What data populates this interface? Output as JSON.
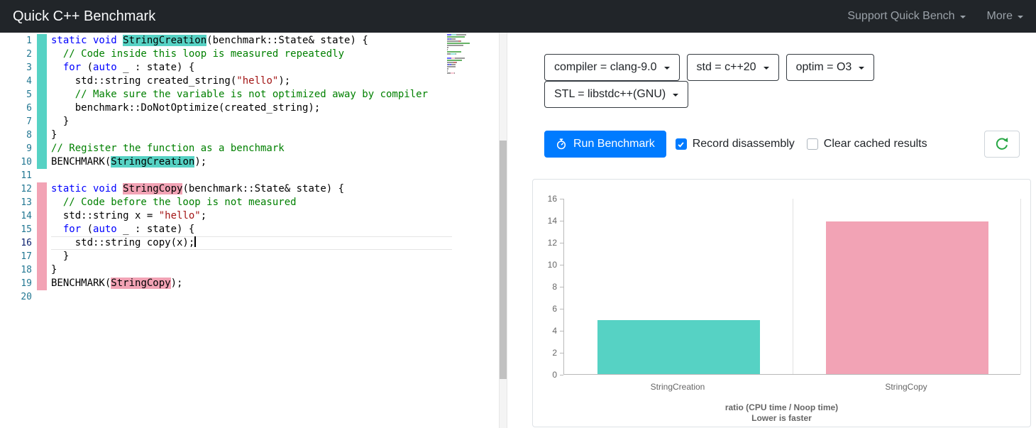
{
  "navbar": {
    "title": "Quick C++ Benchmark",
    "support_label": "Support Quick Bench",
    "more_label": "More"
  },
  "colors": {
    "teal": "#56d2c4",
    "pink": "#f2a3b5",
    "primary": "#007bff",
    "success": "#28a745",
    "keyword": "#0000ff",
    "comment": "#008000",
    "string": "#a31515"
  },
  "icons": {
    "caret_down": "caret-down-triangle",
    "run": "stopwatch-icon",
    "record_check": "checkmark-icon",
    "refresh": "refresh-icon"
  },
  "editor": {
    "lines": [
      {
        "n": 1,
        "stripe": "teal",
        "cur": false,
        "seg": [
          [
            "k",
            "static void "
          ],
          [
            "ht",
            "StringCreation"
          ],
          [
            "p",
            "(benchmark::State& state) {"
          ]
        ]
      },
      {
        "n": 2,
        "stripe": "teal",
        "cur": false,
        "seg": [
          [
            "c",
            "  // Code inside this loop is measured repeatedly"
          ]
        ]
      },
      {
        "n": 3,
        "stripe": "teal",
        "cur": false,
        "seg": [
          [
            "p",
            "  "
          ],
          [
            "k",
            "for"
          ],
          [
            "p",
            " ("
          ],
          [
            "k",
            "auto"
          ],
          [
            "p",
            " _ : state) {"
          ]
        ]
      },
      {
        "n": 4,
        "stripe": "teal",
        "cur": false,
        "seg": [
          [
            "p",
            "    std::string created_string("
          ],
          [
            "s",
            "\"hello\""
          ],
          [
            "p",
            ");"
          ]
        ]
      },
      {
        "n": 5,
        "stripe": "teal",
        "cur": false,
        "seg": [
          [
            "c",
            "    // Make sure the variable is not optimized away by compiler"
          ]
        ]
      },
      {
        "n": 6,
        "stripe": "teal",
        "cur": false,
        "seg": [
          [
            "p",
            "    benchmark::DoNotOptimize(created_string);"
          ]
        ]
      },
      {
        "n": 7,
        "stripe": "teal",
        "cur": false,
        "seg": [
          [
            "p",
            "  }"
          ]
        ]
      },
      {
        "n": 8,
        "stripe": "teal",
        "cur": false,
        "seg": [
          [
            "p",
            "}"
          ]
        ]
      },
      {
        "n": 9,
        "stripe": "teal",
        "cur": false,
        "seg": [
          [
            "c",
            "// Register the function as a benchmark"
          ]
        ]
      },
      {
        "n": 10,
        "stripe": "teal",
        "cur": false,
        "seg": [
          [
            "p",
            "BENCHMARK("
          ],
          [
            "ht",
            "StringCreation"
          ],
          [
            "p",
            ");"
          ]
        ]
      },
      {
        "n": 11,
        "stripe": null,
        "cur": false,
        "seg": []
      },
      {
        "n": 12,
        "stripe": "pink",
        "cur": false,
        "seg": [
          [
            "k",
            "static void "
          ],
          [
            "hp",
            "StringCopy"
          ],
          [
            "p",
            "(benchmark::State& state) {"
          ]
        ]
      },
      {
        "n": 13,
        "stripe": "pink",
        "cur": false,
        "seg": [
          [
            "c",
            "  // Code before the loop is not measured"
          ]
        ]
      },
      {
        "n": 14,
        "stripe": "pink",
        "cur": false,
        "seg": [
          [
            "p",
            "  std::string x = "
          ],
          [
            "s",
            "\"hello\""
          ],
          [
            "p",
            ";"
          ]
        ]
      },
      {
        "n": 15,
        "stripe": "pink",
        "cur": false,
        "seg": [
          [
            "p",
            "  "
          ],
          [
            "k",
            "for"
          ],
          [
            "p",
            " ("
          ],
          [
            "k",
            "auto"
          ],
          [
            "p",
            " _ : state) {"
          ]
        ]
      },
      {
        "n": 16,
        "stripe": "pink",
        "cur": true,
        "seg": [
          [
            "p",
            "    std::string copy(x);"
          ]
        ]
      },
      {
        "n": 17,
        "stripe": "pink",
        "cur": false,
        "seg": [
          [
            "p",
            "  }"
          ]
        ]
      },
      {
        "n": 18,
        "stripe": "pink",
        "cur": false,
        "seg": [
          [
            "p",
            "}"
          ]
        ]
      },
      {
        "n": 19,
        "stripe": "pink",
        "cur": false,
        "seg": [
          [
            "p",
            "BENCHMARK("
          ],
          [
            "hp",
            "StringCopy"
          ],
          [
            "p",
            ");"
          ]
        ]
      },
      {
        "n": 20,
        "stripe": null,
        "cur": false,
        "seg": []
      }
    ]
  },
  "controls": {
    "dropdowns": [
      "compiler = clang-9.0",
      "std = c++20",
      "optim = O3",
      "STL = libstdc++(GNU)"
    ],
    "run_button": "Run Benchmark",
    "checkboxes": [
      {
        "label": "Record disassembly",
        "checked": true
      },
      {
        "label": "Clear cached results",
        "checked": false
      }
    ]
  },
  "chart_data": {
    "type": "bar",
    "categories": [
      "StringCreation",
      "StringCopy"
    ],
    "values": [
      4.9,
      13.9
    ],
    "colors": [
      "#56d2c4",
      "#f2a3b5"
    ],
    "title": "ratio (CPU time / Noop time)",
    "subtitle": "Lower is faster",
    "xlabel": "",
    "ylabel": "",
    "ylim": [
      0,
      16
    ],
    "yticks": [
      0,
      2,
      4,
      6,
      8,
      10,
      12,
      14,
      16
    ],
    "grid": "vertical-only",
    "legend": "none"
  }
}
